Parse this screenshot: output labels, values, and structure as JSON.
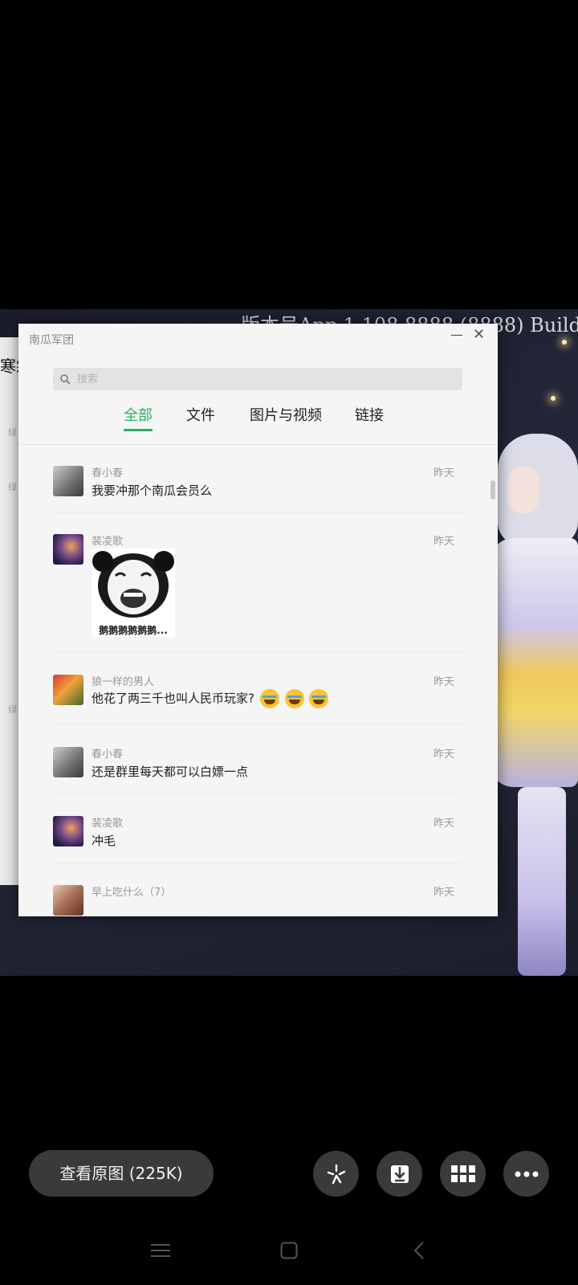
{
  "background": {
    "version_text": "版本号App 1.108.8888 (8888)  Build",
    "left_panel_text": "寒霜",
    "left_panel_gray": "绿"
  },
  "window": {
    "title": "南瓜军团",
    "min_icon": "minimize-icon",
    "close_icon": "close-icon",
    "search": {
      "placeholder": "搜索",
      "value": ""
    },
    "tabs": [
      {
        "label": "全部",
        "active": true
      },
      {
        "label": "文件",
        "active": false
      },
      {
        "label": "图片与视频",
        "active": false
      },
      {
        "label": "链接",
        "active": false
      }
    ],
    "messages": [
      {
        "sender": "春小春",
        "time": "昨天",
        "text": "我要冲那个南瓜会员么"
      },
      {
        "sender": "裴凌歌",
        "time": "昨天",
        "sticker_caption": "鹅鹅鹅鹅鹅鹅..."
      },
      {
        "sender": "狼一样的男人",
        "time": "昨天",
        "text": "他花了两三千也叫人民币玩家?"
      },
      {
        "sender": "春小春",
        "time": "昨天",
        "text": "还是群里每天都可以白嫖一点"
      },
      {
        "sender": "裴凌歌",
        "time": "昨天",
        "text": "冲毛"
      },
      {
        "sender": "早上吃什么（7）",
        "time": "昨天"
      }
    ]
  },
  "viewer": {
    "view_original": "查看原图 (225K)",
    "actions": [
      "sparkle-icon",
      "download-icon",
      "grid-icon",
      "more-icon"
    ]
  },
  "colors": {
    "accent": "#2aae67",
    "button_bg": "#3a3a3a"
  }
}
